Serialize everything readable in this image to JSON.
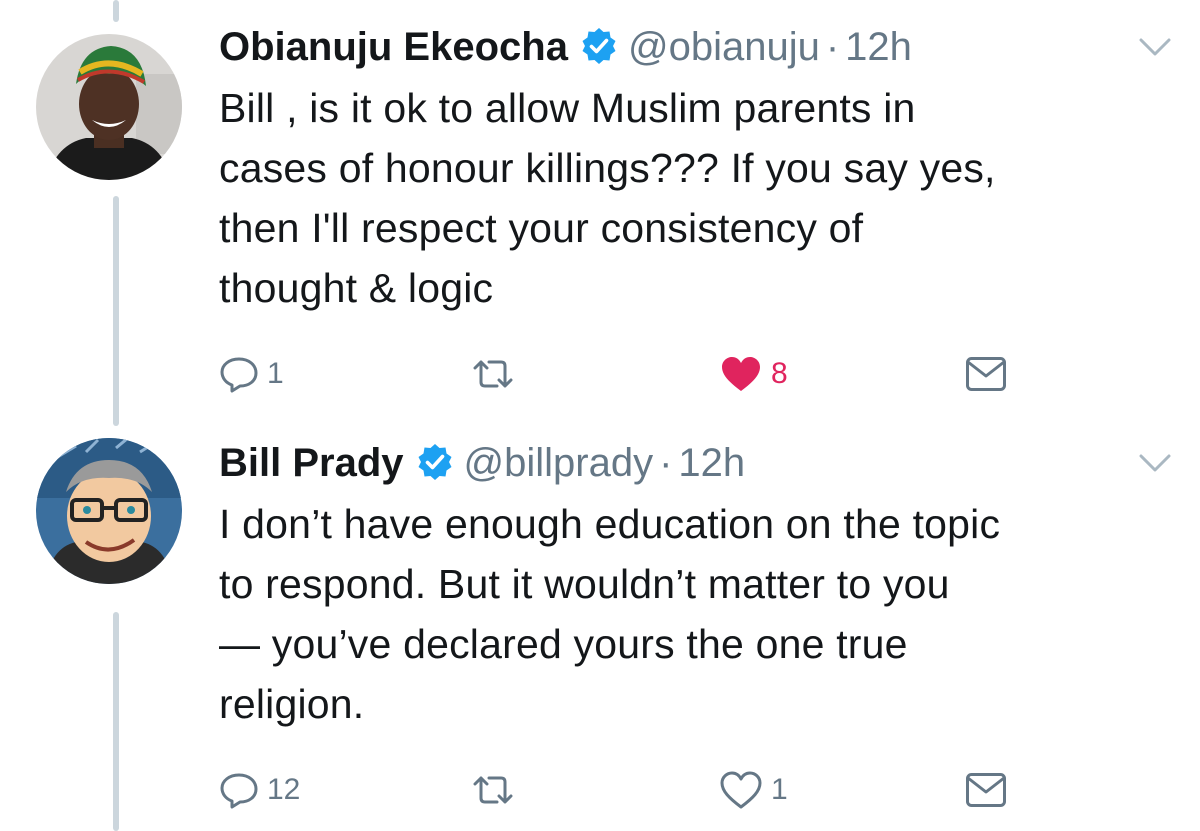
{
  "colors": {
    "text": "#14171a",
    "secondary": "#657786",
    "verified": "#1da1f2",
    "like": "#e0245e",
    "thread_line": "#ccd6dd"
  },
  "tweets": [
    {
      "name": "Obianuju Ekeocha",
      "handle": "@obianuju",
      "separator": "·",
      "time": "12h",
      "verified": true,
      "text_lines": [
        "Bill , is it ok to allow Muslim parents in",
        "cases of honour killings??? If you say yes,",
        "then I'll respect your consistency of",
        "thought & logic"
      ],
      "reply_count": "1",
      "retweet_count": "",
      "like_count": "8",
      "liked": true,
      "icons": [
        "reply-icon",
        "retweet-icon",
        "heart-icon",
        "dm-icon",
        "chevron-down-icon"
      ]
    },
    {
      "name": "Bill Prady",
      "handle": "@billprady",
      "separator": "·",
      "time": "12h",
      "verified": true,
      "text_lines": [
        "I don’t have enough education on the topic",
        "to respond.  But it wouldn’t matter to you",
        "— you’ve declared yours the one true",
        "religion."
      ],
      "reply_count": "12",
      "retweet_count": "",
      "like_count": "1",
      "liked": false,
      "icons": [
        "reply-icon",
        "retweet-icon",
        "heart-icon",
        "dm-icon",
        "chevron-down-icon"
      ]
    }
  ]
}
